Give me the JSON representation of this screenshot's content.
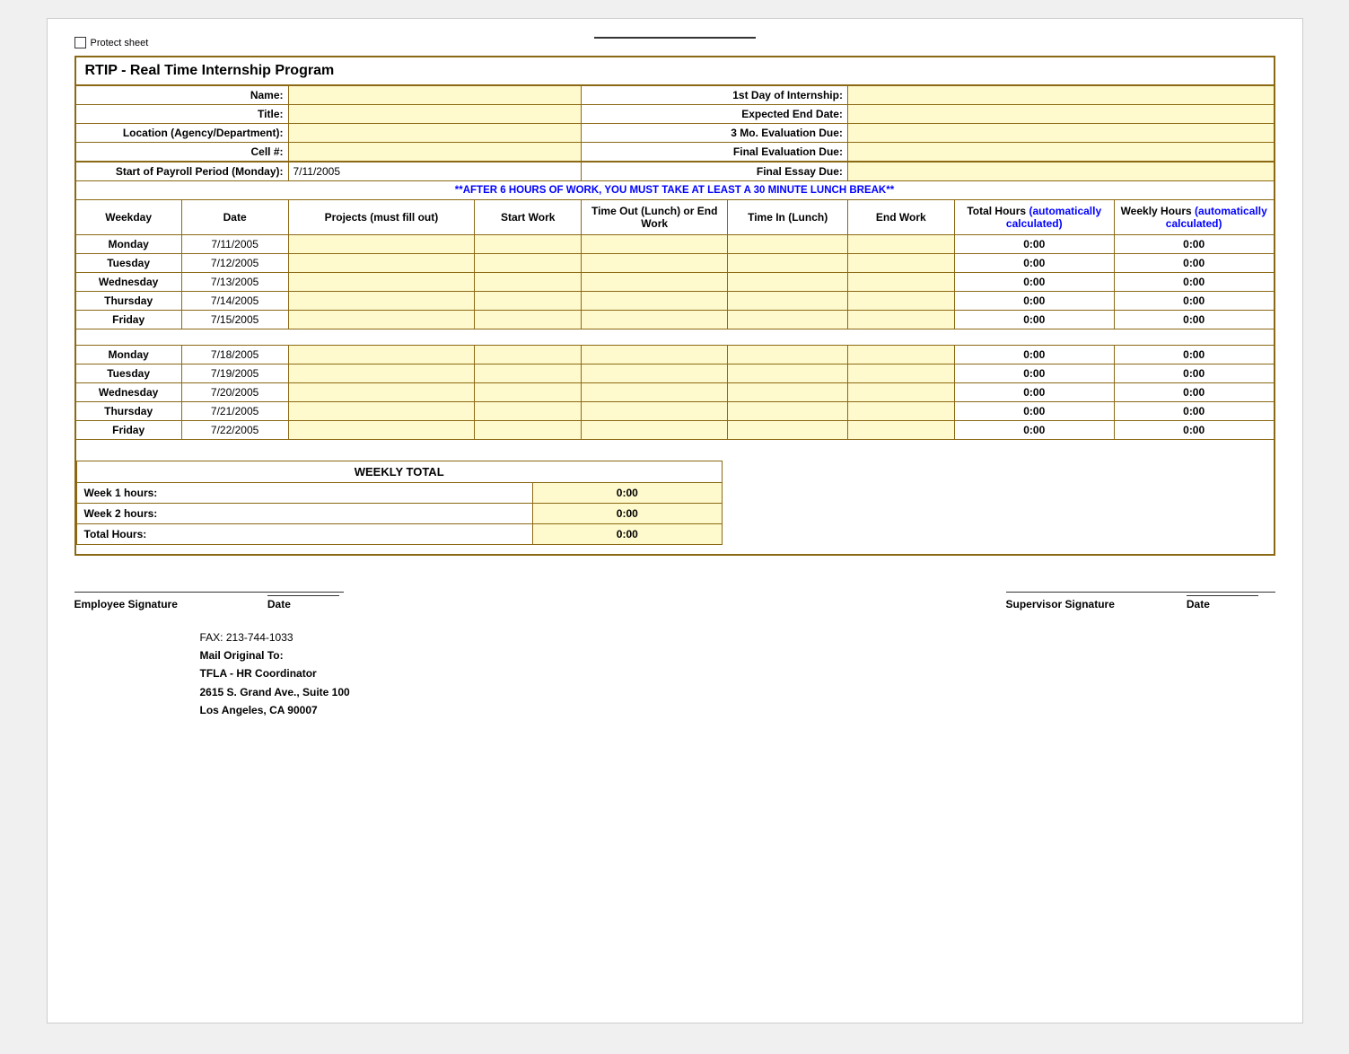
{
  "page": {
    "protect_label": "Protect sheet",
    "title": "RTIP - Real Time Internship Program",
    "fields": {
      "name_label": "Name:",
      "title_label": "Title:",
      "location_label": "Location (Agency/Department):",
      "cell_label": "Cell #:",
      "payroll_label": "Start of Payroll Period (Monday):",
      "payroll_value": "7/11/2005",
      "first_day_label": "1st Day of Internship:",
      "expected_end_label": "Expected End Date:",
      "eval_3mo_label": "3 Mo. Evaluation Due:",
      "final_eval_label": "Final Evaluation Due:",
      "final_essay_label": "Final Essay Due:"
    },
    "warning": "**AFTER 6 HOURS OF WORK, YOU MUST TAKE AT LEAST A 30 MINUTE LUNCH BREAK**",
    "columns": {
      "weekday": "Weekday",
      "date": "Date",
      "projects": "Projects (must fill out)",
      "start_work": "Start Work",
      "time_out": "Time Out (Lunch) or End Work",
      "time_in": "Time In (Lunch)",
      "end_work": "End Work",
      "total_hours": "Total Hours (automatically calculated)",
      "weekly_hours": "Weekly Hours (automatically calculated)"
    },
    "week1": [
      {
        "weekday": "Monday",
        "date": "7/11/2005",
        "total": "0:00",
        "weekly": "0:00"
      },
      {
        "weekday": "Tuesday",
        "date": "7/12/2005",
        "total": "0:00",
        "weekly": "0:00"
      },
      {
        "weekday": "Wednesday",
        "date": "7/13/2005",
        "total": "0:00",
        "weekly": "0:00"
      },
      {
        "weekday": "Thursday",
        "date": "7/14/2005",
        "total": "0:00",
        "weekly": "0:00"
      },
      {
        "weekday": "Friday",
        "date": "7/15/2005",
        "total": "0:00",
        "weekly": "0:00"
      }
    ],
    "week2": [
      {
        "weekday": "Monday",
        "date": "7/18/2005",
        "total": "0:00",
        "weekly": "0:00"
      },
      {
        "weekday": "Tuesday",
        "date": "7/19/2005",
        "total": "0:00",
        "weekly": "0:00"
      },
      {
        "weekday": "Wednesday",
        "date": "7/20/2005",
        "total": "0:00",
        "weekly": "0:00"
      },
      {
        "weekday": "Thursday",
        "date": "7/21/2005",
        "total": "0:00",
        "weekly": "0:00"
      },
      {
        "weekday": "Friday",
        "date": "7/22/2005",
        "total": "0:00",
        "weekly": "0:00"
      }
    ],
    "weekly_total": {
      "header": "WEEKLY TOTAL",
      "week1_label": "Week 1 hours:",
      "week1_value": "0:00",
      "week2_label": "Week 2 hours:",
      "week2_value": "0:00",
      "total_label": "Total Hours:",
      "total_value": "0:00"
    },
    "signatures": {
      "employee_label": "Employee Signature",
      "date_label": "Date",
      "supervisor_label": "Supervisor Signature",
      "date2_label": "Date"
    },
    "footer": {
      "fax": "FAX:  213-744-1033",
      "mail_to": "Mail Original To:",
      "org": "TFLA - HR Coordinator",
      "address": "2615 S. Grand Ave., Suite 100",
      "city": "Los Angeles, CA 90007"
    }
  }
}
